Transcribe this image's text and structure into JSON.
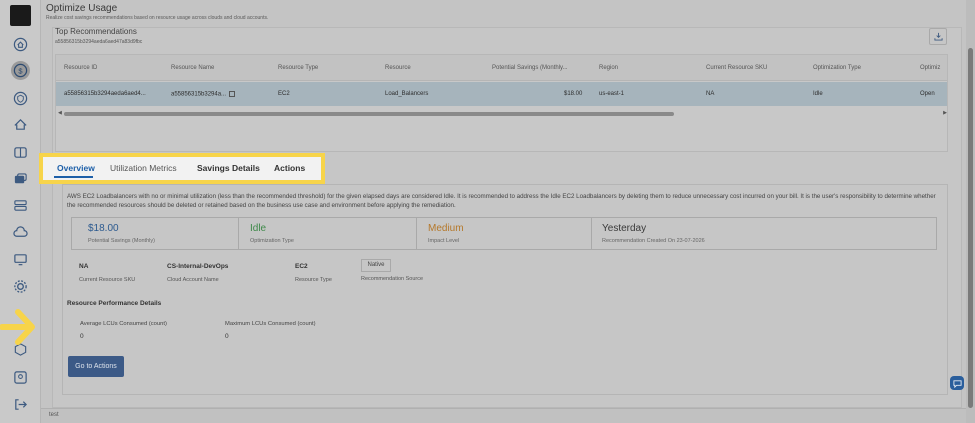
{
  "header": {
    "title": "Optimize Usage",
    "subtitle": "Realize cost savings recommendations based on resource usage across clouds and cloud accounts."
  },
  "recommendations": {
    "title": "Top Recommendations",
    "id": "a55856315b3294aeda6aed47a83d9fbc"
  },
  "table": {
    "columns": [
      "Resource ID",
      "Resource Name",
      "Resource Type",
      "Resource",
      "Potential Savings (Monthly...",
      "Region",
      "Current Resource SKU",
      "Optimization Type",
      "Optimiz"
    ],
    "row": [
      "a55856315b3294aeda6aed4...",
      "a55856315b3294a...",
      "EC2",
      "Load_Balancers",
      "$18.00",
      "us-east-1",
      "NA",
      "Idle",
      "Open"
    ]
  },
  "tabs": [
    "Overview",
    "Utilization Metrics",
    "Savings Details",
    "Actions"
  ],
  "details": {
    "description": "AWS EC2 Loadbalancers with no or minimal utilization (less than the recommended threshold) for the given elapsed days are considered Idle. It is recommended to address the Idle EC2 Loadbalancers by deleting them to reduce unnecessary cost incurred on your bill. It is the user's responsibility to determine whether the recommended resources should be deleted or retained based on the business use case and environment before applying the remediation.",
    "stats": [
      {
        "value": "$18.00",
        "label": "Potential Savings (Monthly)",
        "color": "#2c5a8f"
      },
      {
        "value": "Idle",
        "label": "Optimization Type",
        "color": "#3f8a4a"
      },
      {
        "value": "Medium",
        "label": "Impact Level",
        "color": "#b5782a"
      },
      {
        "value": "Yesterday",
        "label": "Recommendation Created On 23-07-2026",
        "color": "#333333"
      }
    ],
    "info": [
      {
        "value": "NA",
        "label": "Current Resource SKU"
      },
      {
        "value": "CS-Internal-DevOps",
        "label": "Cloud Account Name"
      },
      {
        "value": "EC2",
        "label": "Resource Type"
      }
    ],
    "source": {
      "value": "Native",
      "label": "Recommendation Source"
    },
    "performance_title": "Resource Performance Details",
    "metrics": [
      {
        "label": "Average LCUs Consumed (count)",
        "value": "0"
      },
      {
        "label": "Maximum LCUs Consumed (count)",
        "value": "0"
      }
    ],
    "action_button": "Go to Actions"
  },
  "footer": {
    "text": "test"
  },
  "colors": {
    "accent": "#1d5fa8",
    "highlight": "#f7d44a"
  }
}
